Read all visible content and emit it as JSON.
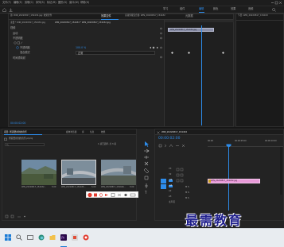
{
  "menubar": {
    "items": [
      "文件(F)",
      "编辑(E)",
      "剪辑(C)",
      "序列(S)",
      "标记(M)",
      "图形(G)",
      "窗口(W)",
      "帮助(H)"
    ]
  },
  "workspaces": {
    "items": [
      "学习",
      "组件",
      "编辑",
      "颜色",
      "效果",
      "音频"
    ],
    "active": "编辑"
  },
  "effect_controls": {
    "tabs": [
      "源: WIN_20220817_154432.jpg: 效果控件",
      "效果控件",
      "音频剪辑混合器: WIN_20220817_154432",
      "元数据"
    ],
    "active_tab": "效果控件",
    "source_line": "主要 * WIN_20220817_154432.jpg",
    "sequence_line": "WIN_20220817_154432 * WIN_20220817_154432.jpg",
    "clip_label": "WIN_20220817_154432.jpg",
    "section_video": "视频",
    "rows": [
      {
        "label": "运动",
        "value": ""
      },
      {
        "label": "不透明度",
        "value": ""
      },
      {
        "label": "不透明度",
        "value": "100.0 %"
      },
      {
        "label": "混合模式",
        "value": "正常"
      },
      {
        "label": "时间重映射",
        "value": ""
      }
    ],
    "timecode": "00:00:02:00"
  },
  "program_panel": {
    "title": "节目: WIN_20220817_154432"
  },
  "project_panel": {
    "tabs": [
      "项目: 所需要用到的音乐",
      "媒体浏览器",
      "库",
      "信息",
      "效果"
    ],
    "path": "所需要用到的音乐.prproj",
    "count": "1 项已选择, 共 3 项",
    "items": [
      {
        "name": "WIN_20220817_154432...",
        "duration": "5:00"
      },
      {
        "name": "WIN_20220817_154435...",
        "duration": "5:00"
      },
      {
        "name": "WIN_20220817_154440...",
        "duration": "5:00"
      }
    ]
  },
  "timeline": {
    "tab": "WIN_20220817_154432",
    "timecode": "00:00:02:00",
    "ruler": [
      "00:00",
      "00:00:05:00",
      "00:00:10:00"
    ],
    "tracks": [
      "V3",
      "V2",
      "V1",
      "A1",
      "A2",
      "A3",
      "主声道"
    ],
    "clip": "WIN_20220817_154432.jpg"
  },
  "watermark": "最需教育",
  "colors": {
    "accent": "#2d8ceb",
    "clip_pink": "#e89ad8",
    "clip_lilac": "#8a8fa8"
  }
}
